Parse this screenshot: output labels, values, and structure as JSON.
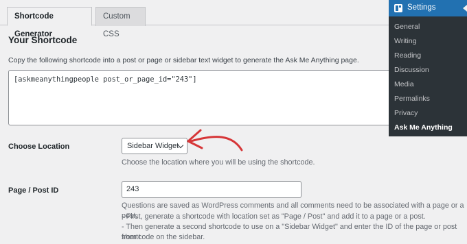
{
  "tabs": [
    {
      "label": "Shortcode Generator",
      "active": true
    },
    {
      "label": "Custom CSS",
      "active": false
    }
  ],
  "section": {
    "title": "Your Shortcode",
    "description": "Copy the following shortcode into a post or page or sidebar text widget to generate the Ask Me Anything page."
  },
  "shortcode": "[askmeanythingpeople post_or_page_id=\"243\"]",
  "location": {
    "label": "Choose Location",
    "selected": "Sidebar Widget",
    "hint": "Choose the location where you will be using the shortcode."
  },
  "page_post": {
    "label": "Page / Post ID",
    "value": "243",
    "hint_lines": [
      "Questions are saved as WordPress comments and all comments need to be associated with a page or a post.",
      "- First, generate a shortcode with location set as \"Page / Post\" and add it to a page or a post.",
      "- Then generate a second shortcode to use on a \"Sidebar Widget\" and enter the ID of the page or post from t",
      "shortcode on the sidebar."
    ]
  },
  "admin_menu": {
    "header": "Settings",
    "items": [
      "General",
      "Writing",
      "Reading",
      "Discussion",
      "Media",
      "Permalinks",
      "Privacy",
      "Ask Me Anything"
    ],
    "current_index": 7
  },
  "colors": {
    "accent_blue": "#2271b1",
    "menu_bg": "#2c3338",
    "annotation_arrow": "#d63638"
  }
}
